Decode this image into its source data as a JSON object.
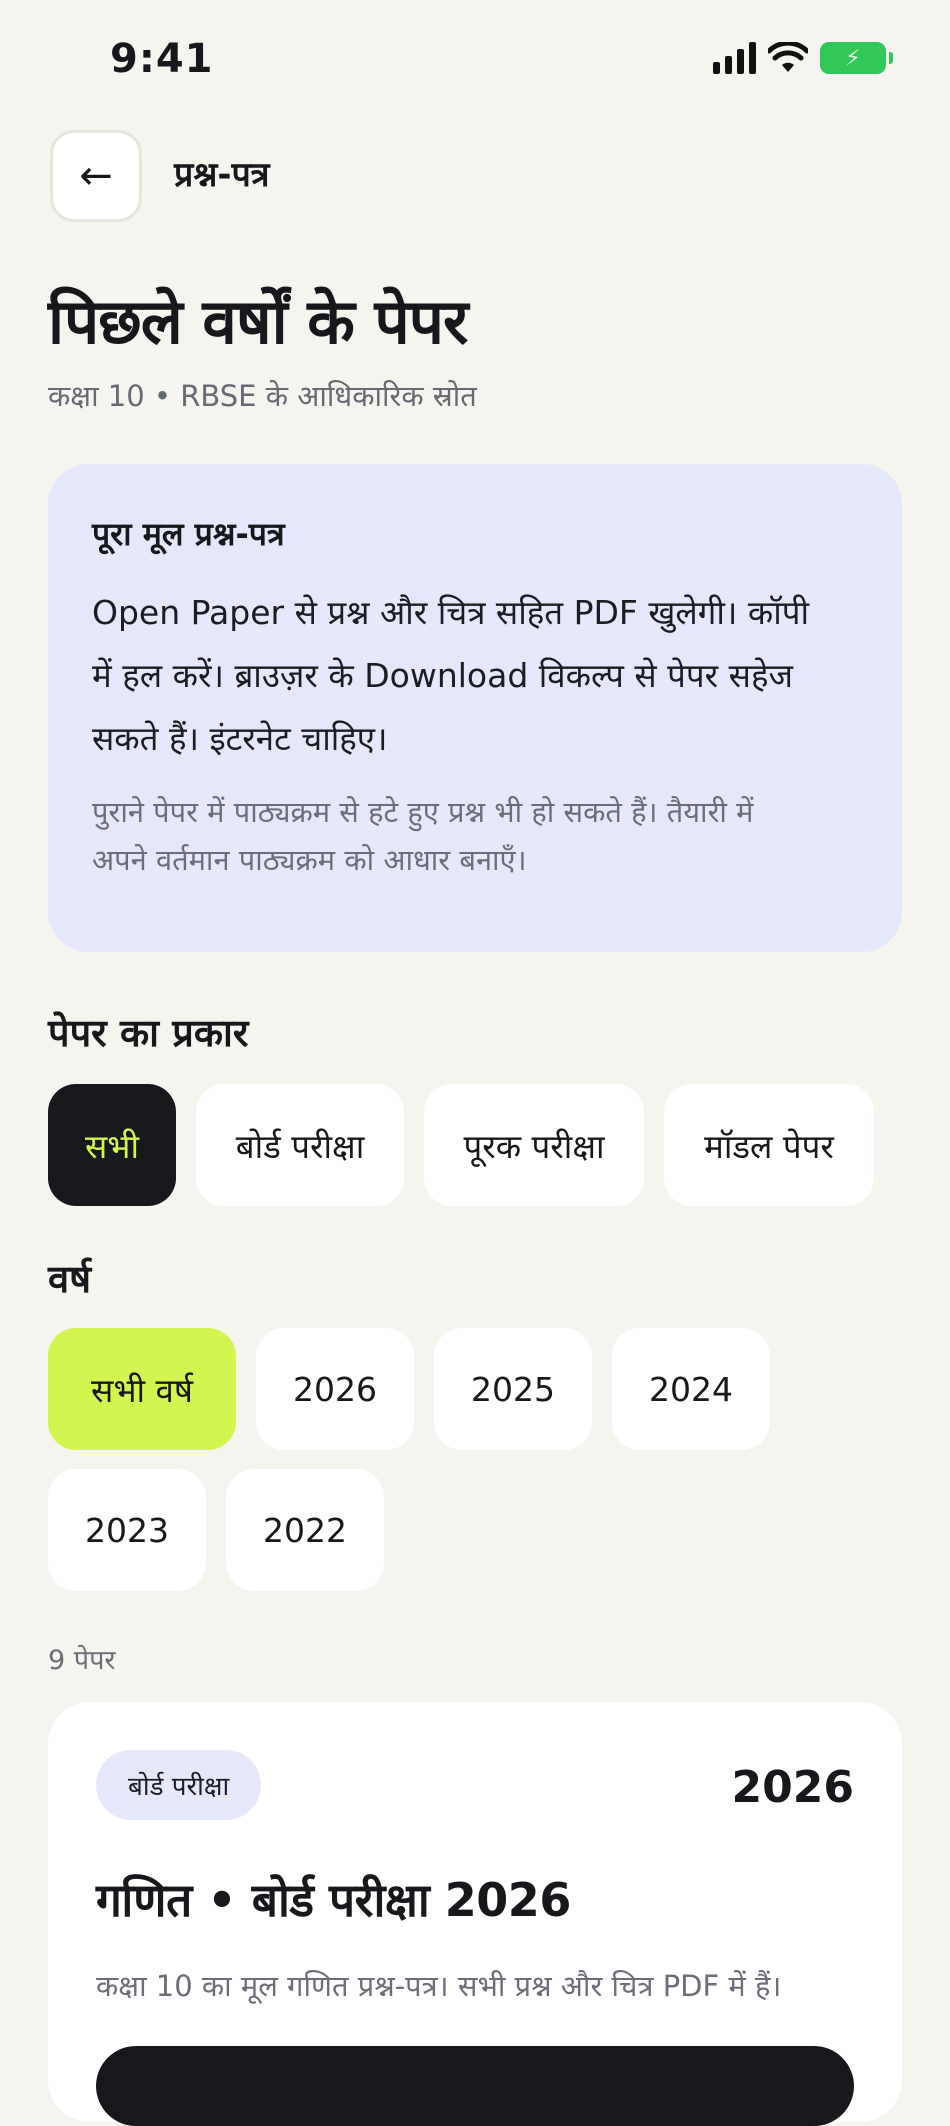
{
  "status_bar": {
    "time": "9:41"
  },
  "header": {
    "back_icon": "←",
    "crumb": "प्रश्न-पत्र"
  },
  "page": {
    "title": "पिछले वर्षों के पेपर",
    "subtitle": "कक्षा 10 • RBSE के आधिकारिक स्रोत"
  },
  "info": {
    "title": "पूरा मूल प्रश्न-पत्र",
    "line1": "Open Paper से प्रश्न और चित्र सहित PDF खुलेगी। कॉपी",
    "line2": "में हल करें। ब्राउज़र के Download विकल्प से पेपर सहेज",
    "line3": "सकते हैं। इंटरनेट चाहिए।",
    "note1": "पुराने पेपर में पाठ्यक्रम से हटे हुए प्रश्न भी हो सकते हैं। तैयारी में",
    "note2": "अपने वर्तमान पाठ्यक्रम को आधार बनाएँ।"
  },
  "filters": {
    "type_label": "पेपर का प्रकार",
    "types": [
      "सभी",
      "बोर्ड परीक्षा",
      "पूरक परीक्षा",
      "मॉडल पेपर"
    ],
    "year_label": "वर्ष",
    "years": [
      "सभी वर्ष",
      "2026",
      "2025",
      "2024",
      "2023",
      "2022"
    ]
  },
  "results": {
    "count": "9 पेपर"
  },
  "papers": [
    {
      "badge": "बोर्ड परीक्षा",
      "year": "2026",
      "title": "गणित • बोर्ड परीक्षा 2026",
      "desc": "कक्षा 10 का मूल गणित प्रश्न-पत्र। सभी प्रश्न और चित्र PDF में हैं।"
    }
  ],
  "colors": {
    "background": "#f5f4ee",
    "accent_lime": "#d3f54f",
    "dark": "#17181c",
    "card_tint": "#e5e7fa"
  }
}
